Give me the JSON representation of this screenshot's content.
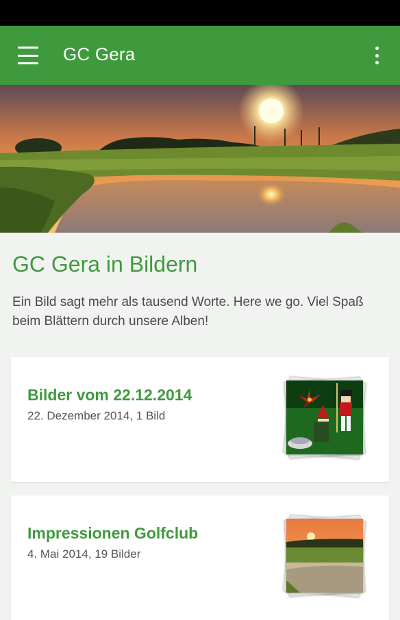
{
  "app_bar": {
    "title": "GC Gera",
    "menu_icon": "hamburger-menu-icon",
    "overflow_icon": "overflow-menu-icon",
    "color": "#3f9a3d"
  },
  "hero": {
    "icon": "golf-course-sunset-image"
  },
  "section": {
    "title": "GC Gera in Bildern",
    "description": "Ein Bild sagt mehr als tausend Worte. Here we go. Viel Spaß beim Blättern durch unsere Alben!"
  },
  "albums": [
    {
      "title": "Bilder vom 22.12.2014",
      "meta": "22. Dezember 2014, 1 Bild",
      "thumbnail": "christmas-decoration-photo"
    },
    {
      "title": "Impressionen Golfclub",
      "meta": "4. Mai 2014, 19 Bilder",
      "thumbnail": "golf-course-sunset-photo"
    }
  ],
  "colors": {
    "accent": "#3f9a3d",
    "background": "#f1f3f1",
    "card": "#ffffff"
  }
}
